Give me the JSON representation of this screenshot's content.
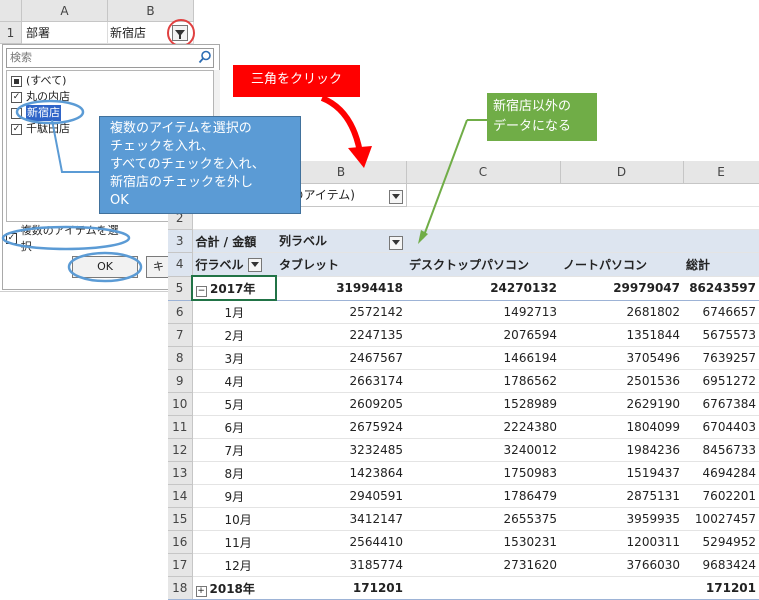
{
  "sheet": {
    "col_a": "A",
    "col_b": "B",
    "row_1": "1",
    "a1": "部署",
    "b1": "新宿店"
  },
  "filter": {
    "search_placeholder": "検索",
    "items": [
      {
        "label": "(すべて)",
        "state": "partial"
      },
      {
        "label": "丸の内店",
        "state": "checked"
      },
      {
        "label": "新宿店",
        "state": "unchecked"
      },
      {
        "label": "千駄田店",
        "state": "checked"
      }
    ],
    "multi_label": "複数のアイテムを選択",
    "ok_label": "OK",
    "cancel_label": "キ"
  },
  "callouts": {
    "red": "三角をクリック",
    "green_line1": "新宿店以外の",
    "green_line2": "データになる",
    "blue_line1": "複数のアイテムを選択の",
    "blue_line2": "チェックを入れ、",
    "blue_line3": "すべてのチェックを入れ、",
    "blue_line4": "新宿店のチェックを外し",
    "blue_line5": "OK"
  },
  "pivot": {
    "col_headers": [
      "B",
      "C",
      "D",
      "E"
    ],
    "filter_value": "数のアイテム)",
    "summary_label": "合計 / 金額",
    "col_label": "列ラベル",
    "row_label": "行ラベル",
    "headers": [
      "タブレット",
      "デスクトップパソコン",
      "ノートパソコン",
      "総計"
    ],
    "year_rows": [
      {
        "row": "5",
        "label": "2017年",
        "values": [
          "31994418",
          "24270132",
          "29979047",
          "86243597"
        ]
      }
    ],
    "months": [
      {
        "row": "6",
        "label": "1月",
        "values": [
          "2572142",
          "1492713",
          "2681802",
          "6746657"
        ]
      },
      {
        "row": "7",
        "label": "2月",
        "values": [
          "2247135",
          "2076594",
          "1351844",
          "5675573"
        ]
      },
      {
        "row": "8",
        "label": "3月",
        "values": [
          "2467567",
          "1466194",
          "3705496",
          "7639257"
        ]
      },
      {
        "row": "9",
        "label": "4月",
        "values": [
          "2663174",
          "1786562",
          "2501536",
          "6951272"
        ]
      },
      {
        "row": "10",
        "label": "5月",
        "values": [
          "2609205",
          "1528989",
          "2629190",
          "6767384"
        ]
      },
      {
        "row": "11",
        "label": "6月",
        "values": [
          "2675924",
          "2224380",
          "1804099",
          "6704403"
        ]
      },
      {
        "row": "12",
        "label": "7月",
        "values": [
          "3232485",
          "3240012",
          "1984236",
          "8456733"
        ]
      },
      {
        "row": "13",
        "label": "8月",
        "values": [
          "1423864",
          "1750983",
          "1519437",
          "4694284"
        ]
      },
      {
        "row": "14",
        "label": "9月",
        "values": [
          "2940591",
          "1786479",
          "2875131",
          "7602201"
        ]
      },
      {
        "row": "15",
        "label": "10月",
        "values": [
          "3412147",
          "2655375",
          "3959935",
          "10027457"
        ]
      },
      {
        "row": "16",
        "label": "11月",
        "values": [
          "2564410",
          "1530231",
          "1200311",
          "5294952"
        ]
      },
      {
        "row": "17",
        "label": "12月",
        "values": [
          "3185774",
          "2731620",
          "3766030",
          "9683424"
        ]
      }
    ],
    "next_year": {
      "row": "18",
      "label": "2018年",
      "values": [
        "171201",
        "",
        "",
        "171201"
      ]
    },
    "row_numbers": {
      "r2": "2",
      "r3": "3",
      "r4": "4"
    }
  },
  "colors": {
    "red_callout": "#ff0000",
    "green_callout": "#70ad47",
    "blue_callout": "#5b9bd5",
    "selected_item": "#2f64c8"
  }
}
